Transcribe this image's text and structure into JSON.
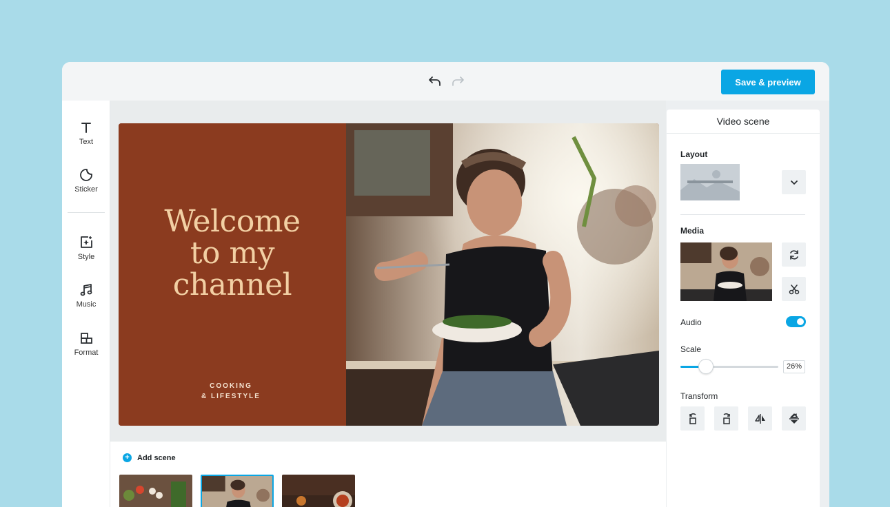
{
  "toolbar": {
    "save_label": "Save & preview",
    "undo_icon": "undo-icon",
    "redo_icon": "redo-icon"
  },
  "left_tools": [
    {
      "label": "Text",
      "icon": "text-icon"
    },
    {
      "label": "Sticker",
      "icon": "sticker-icon"
    },
    {
      "label": "Style",
      "icon": "style-icon"
    },
    {
      "label": "Music",
      "icon": "music-icon"
    },
    {
      "label": "Format",
      "icon": "format-icon"
    }
  ],
  "slide": {
    "title_line1": "Welcome",
    "title_line2": "to my",
    "title_line3": "channel",
    "subtitle_line1": "COOKING",
    "subtitle_line2": "& LIFESTYLE"
  },
  "panel": {
    "title": "Video scene",
    "layout_label": "Layout",
    "media_label": "Media",
    "audio_label": "Audio",
    "audio_on": true,
    "scale_label": "Scale",
    "scale_value": "26%",
    "scale_fraction": 0.26,
    "transform_label": "Transform"
  },
  "timeline": {
    "add_scene_label": "Add scene",
    "selected_scene_index": 1
  },
  "colors": {
    "accent": "#0aa6e4",
    "slide_bg": "#8b3b1f",
    "slide_title": "#f2d0a4",
    "backdrop": "#a9dbe9"
  }
}
